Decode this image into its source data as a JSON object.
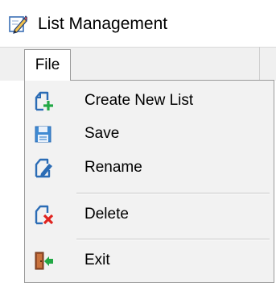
{
  "window": {
    "title": "List Management",
    "title_icon": "edit-pencil-icon"
  },
  "menubar": {
    "file_label": "File"
  },
  "file_menu": {
    "items": [
      {
        "label": "Create New List",
        "icon": "new-document-plus-icon"
      },
      {
        "label": "Save",
        "icon": "floppy-save-icon"
      },
      {
        "label": "Rename",
        "icon": "rename-pencil-icon"
      },
      {
        "label": "Delete",
        "icon": "delete-document-x-icon"
      },
      {
        "label": "Exit",
        "icon": "exit-door-icon"
      }
    ]
  },
  "colors": {
    "menu_background": "#f2f2f2",
    "icon_blue": "#2b6cb5",
    "icon_green": "#22a845",
    "icon_red": "#e0231f"
  }
}
